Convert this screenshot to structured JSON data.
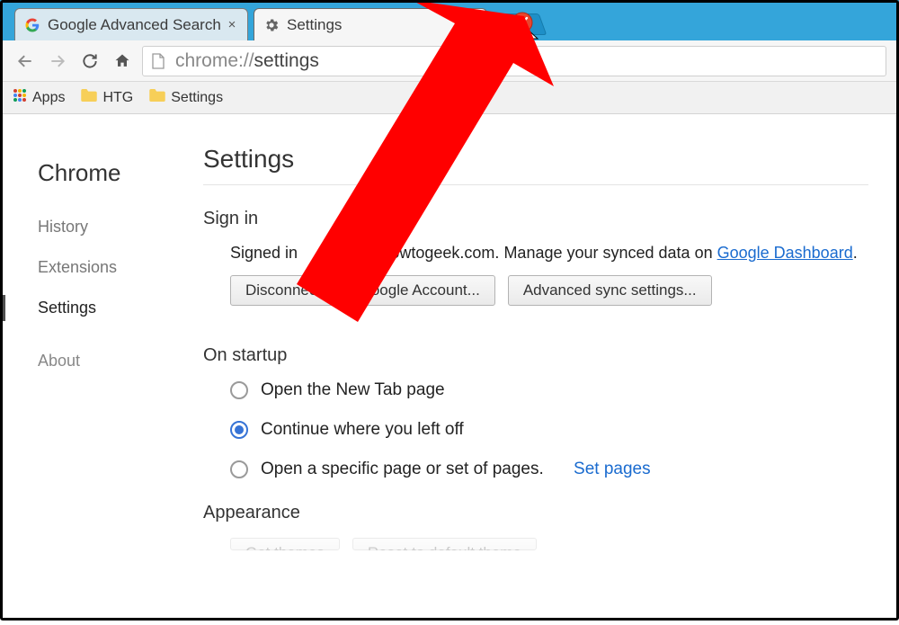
{
  "tabs": [
    {
      "label": "Google Advanced Search"
    },
    {
      "label": "Settings"
    }
  ],
  "omnibox": {
    "scheme": "chrome://",
    "path": "settings"
  },
  "bookmarks": {
    "apps": "Apps",
    "htg": "HTG",
    "settings": "Settings"
  },
  "sidebar": {
    "brand": "Chrome",
    "history": "History",
    "extensions": "Extensions",
    "settings": "Settings",
    "about": "About"
  },
  "settings": {
    "title": "Settings",
    "signin": {
      "heading": "Sign in",
      "prefix": "Signed in",
      "email_suffix": "@howtogeek.com.",
      "manage_text": "Manage your synced data on",
      "dashboard_link": "Google Dashboard",
      "disconnect_btn": "Disconnect your Google Account...",
      "advanced_btn": "Advanced sync settings..."
    },
    "startup": {
      "heading": "On startup",
      "opt_newtab": "Open the New Tab page",
      "opt_continue": "Continue where you left off",
      "opt_specific": "Open a specific page or set of pages.",
      "set_pages": "Set pages"
    },
    "appearance": {
      "heading": "Appearance"
    }
  }
}
